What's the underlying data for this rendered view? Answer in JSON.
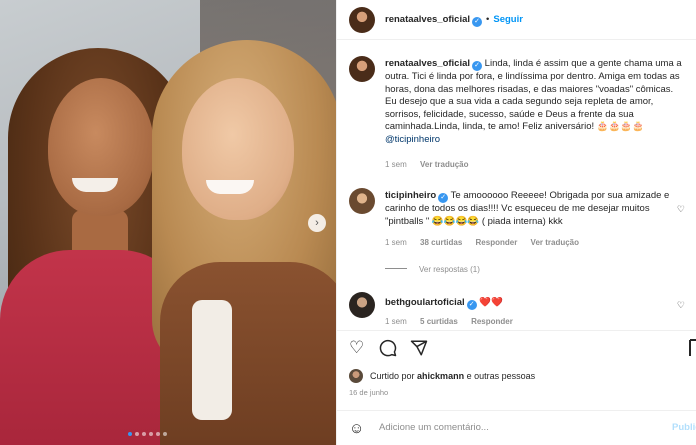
{
  "post": {
    "author": "renataalves_oficial",
    "follow_label": "Seguir",
    "carousel": {
      "current_slide": 1,
      "slide_count": 6
    }
  },
  "comments": [
    {
      "user": "renataalves_oficial",
      "text": "Linda, linda é assim que a gente chama uma a outra. Tici é linda por fora, e lindíssima por dentro. Amiga em todas as horas, dona das melhores risadas, e das maiores \"voadas\" cômicas. Eu desejo que a sua vida a cada segundo seja repleta de amor, sorrisos, felicidade, sucesso, saúde e Deus a frente da sua caminhada.Linda, linda, te amo! Feliz aniversário! 🎂🎂🎂🎂",
      "mention": "@ticipinheiro",
      "time": "1 sem",
      "translate": "Ver tradução"
    },
    {
      "user": "ticipinheiro",
      "text": "Te amoooooo Reeeee! Obrigada por sua amizade e carinho de todos os dias!!!! Vc esqueceu de me desejar muitos \"pintballs \" 😂😂😂😂 ( piada interna) kkk",
      "time": "1 sem",
      "likes": "38 curtidas",
      "reply": "Responder",
      "translate": "Ver tradução"
    },
    {
      "user": "bethgoulartoficial",
      "text": "❤️❤️",
      "time": "1 sem",
      "likes": "5 curtidas",
      "reply": "Responder"
    }
  ],
  "view_replies": "Ver respostas (1)",
  "liked_by": {
    "prefix": "Curtido por",
    "user": "ahickmann",
    "suffix": "e outras pessoas"
  },
  "date": "16 de junho",
  "add_comment": {
    "placeholder": "Adicione um comentário...",
    "publish": "Publica"
  },
  "icons": [
    "heart-icon",
    "comment-icon",
    "share-icon",
    "bookmark-icon",
    "emoji-icon",
    "verified-icon"
  ],
  "colors": {
    "accent": "#0095f6",
    "verified": "#3897f0",
    "muted": "#8e8e8e",
    "heart": "#e0245e"
  }
}
